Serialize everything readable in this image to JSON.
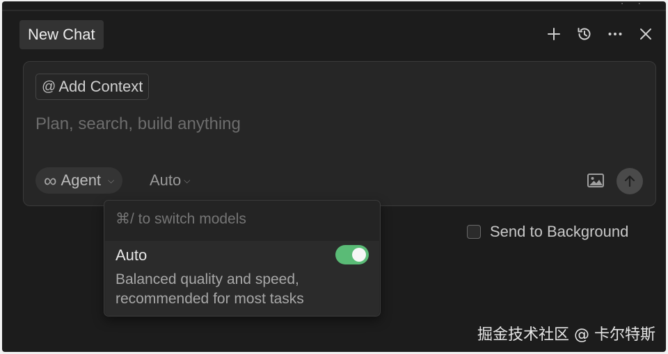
{
  "header": {
    "tab_title": "New Chat",
    "top_glyphs": "· ·"
  },
  "composer": {
    "add_context_label": "Add Context",
    "placeholder": "Plan, search, build anything",
    "mode_label": "Agent",
    "model_label": "Auto"
  },
  "model_menu": {
    "hint": "⌘/ to switch models",
    "option": {
      "name": "Auto",
      "description": "Balanced quality and speed, recommended for most tasks",
      "enabled": true
    }
  },
  "background_option": {
    "label": "Send to Background",
    "checked": false
  },
  "watermark": "掘金技术社区 @ 卡尔特斯",
  "colors": {
    "panel_bg": "#1c1c1c",
    "composer_bg": "#262626",
    "toggle_on": "#5abb76"
  },
  "icons": {
    "new_chat": "plus-icon",
    "history": "history-icon",
    "more": "ellipsis-icon",
    "close": "close-icon",
    "image": "image-icon",
    "send": "arrow-up-icon",
    "mode": "infinity-icon"
  }
}
